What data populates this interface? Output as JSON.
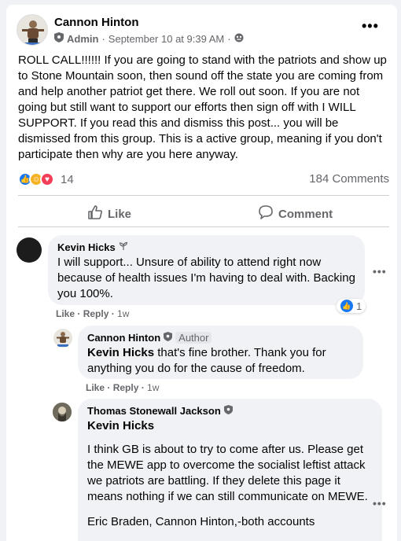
{
  "post": {
    "author": "Cannon Hinton",
    "role": "Admin",
    "timestamp": "September 10 at 9:39 AM",
    "separator": "·",
    "body": "ROLL CALL!!!!!! If you are going to stand with the patriots and show up to Stone Mountain soon, then sound off the state you are coming from and help another patriot get there. We roll out soon. If you are not going but still want to support our efforts then sign off with I WILL SUPPORT. If you read this and dismiss this post... you will be dismissed from this group. This is a active group, meaning if you don't participate then why are you here anyway.",
    "reaction_count": "14",
    "comments_count": "184 Comments",
    "like_label": "Like",
    "comment_label": "Comment"
  },
  "comments": [
    {
      "name": "Kevin Hicks",
      "text": "I will support... Unsure of ability to attend right now because of health issues I'm having to deal with. Backing you 100%.",
      "like": "Like",
      "reply": "Reply",
      "time": "1w",
      "reaction_count": "1"
    },
    {
      "name": "Cannon Hinton",
      "badge": "Author",
      "mention": "Kevin Hicks",
      "text": " that's fine brother. Thank you for anything you do for the cause of freedom.",
      "like": "Like",
      "reply": "Reply",
      "time": "1w"
    },
    {
      "name": "Thomas Stonewall Jackson",
      "mention": "Kevin Hicks",
      "text": "I think GB is about to try to come after us. Please get the MEWE app to overcome the socialist leftist attack we patriots are battling. If they delete this page it means nothing if we can still communicate on MEWE.",
      "text2": "Eric Braden, Cannon Hinton,-both accounts"
    }
  ],
  "colors": {
    "accent": "#1877f2",
    "muted": "#65676b",
    "bubble": "#f0f2f5"
  },
  "icons": [
    "shield-icon",
    "globe-icon",
    "more-icon",
    "like-icon",
    "comment-icon",
    "sprout-icon"
  ]
}
